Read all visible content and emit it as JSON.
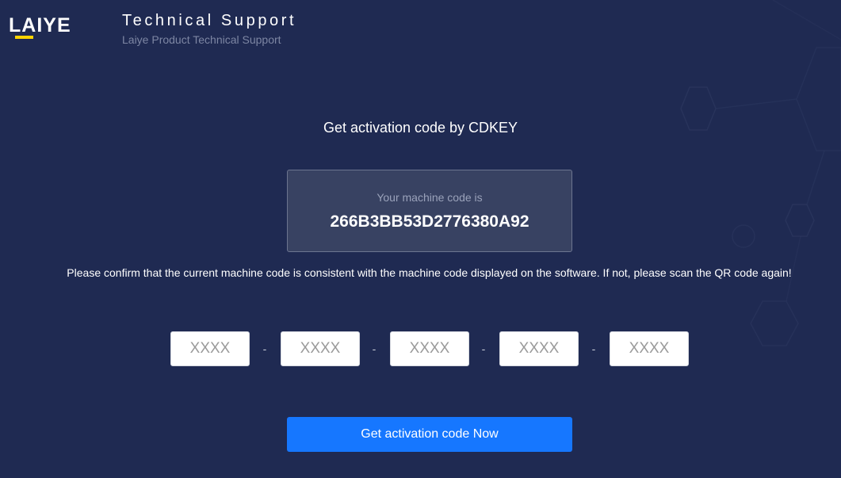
{
  "header": {
    "logo_text": "LAIYE",
    "title": "Technical Support",
    "subtitle": "Laiye Product Technical Support"
  },
  "main": {
    "heading": "Get activation code by CDKEY",
    "machine_label": "Your machine code is",
    "machine_code": "266B3BB53D2776380A92",
    "confirm_text": "Please confirm that the current machine code is consistent with the machine code displayed on the software. If not, please scan the QR code again!",
    "cdkey_fields": [
      {
        "placeholder": "XXXX",
        "value": ""
      },
      {
        "placeholder": "XXXX",
        "value": ""
      },
      {
        "placeholder": "XXXX",
        "value": ""
      },
      {
        "placeholder": "XXXX",
        "value": ""
      },
      {
        "placeholder": "XXXX",
        "value": ""
      }
    ],
    "separator": "-",
    "submit_label": "Get activation code Now"
  },
  "colors": {
    "background": "#1f2a52",
    "logo_accent": "#ffd400",
    "primary_button": "#1677ff",
    "machine_box": "#384262"
  }
}
